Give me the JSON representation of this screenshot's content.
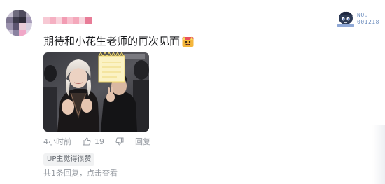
{
  "user": {
    "avatar_colors": [
      "#c9c3d4",
      "#6e6a7d",
      "#4f4b5e",
      "#b9b3c5",
      "#7d7590",
      "#3c394a",
      "#2f2c3a",
      "#a59bb8",
      "#9b92ad",
      "#5c5470",
      "#e8ccd8",
      "#d6d0e0",
      "#c7c0d3",
      "#8a82a0",
      "#f0a8c8",
      "#e3dde9"
    ],
    "name_colors": [
      "#f7c9d4",
      "#f5b0c2",
      "#f9d3dc",
      "#f29cb3",
      "#f8c0ce",
      "#f4a8bb",
      "#f7d6de",
      "#e87c97"
    ]
  },
  "fan_badge": {
    "icon": "fan-character-icon",
    "label_line1": "NO.",
    "label_line2": "001218",
    "color": "#6f8fbf"
  },
  "comment": {
    "text": "期待和小花生老师的再次见面",
    "emoji": "cheering-emoji-icon"
  },
  "photo": {
    "icon": "photo-image"
  },
  "actions": {
    "time": "4小时前",
    "like_count": "19",
    "reply_label": "回复",
    "like_icon": "thumbs-up-icon",
    "dislike_icon": "thumbs-down-icon"
  },
  "up_liked": {
    "label": "UP主觉得很赞"
  },
  "reply_summary": {
    "prefix": "共1条回复，",
    "link": "点击查看"
  }
}
